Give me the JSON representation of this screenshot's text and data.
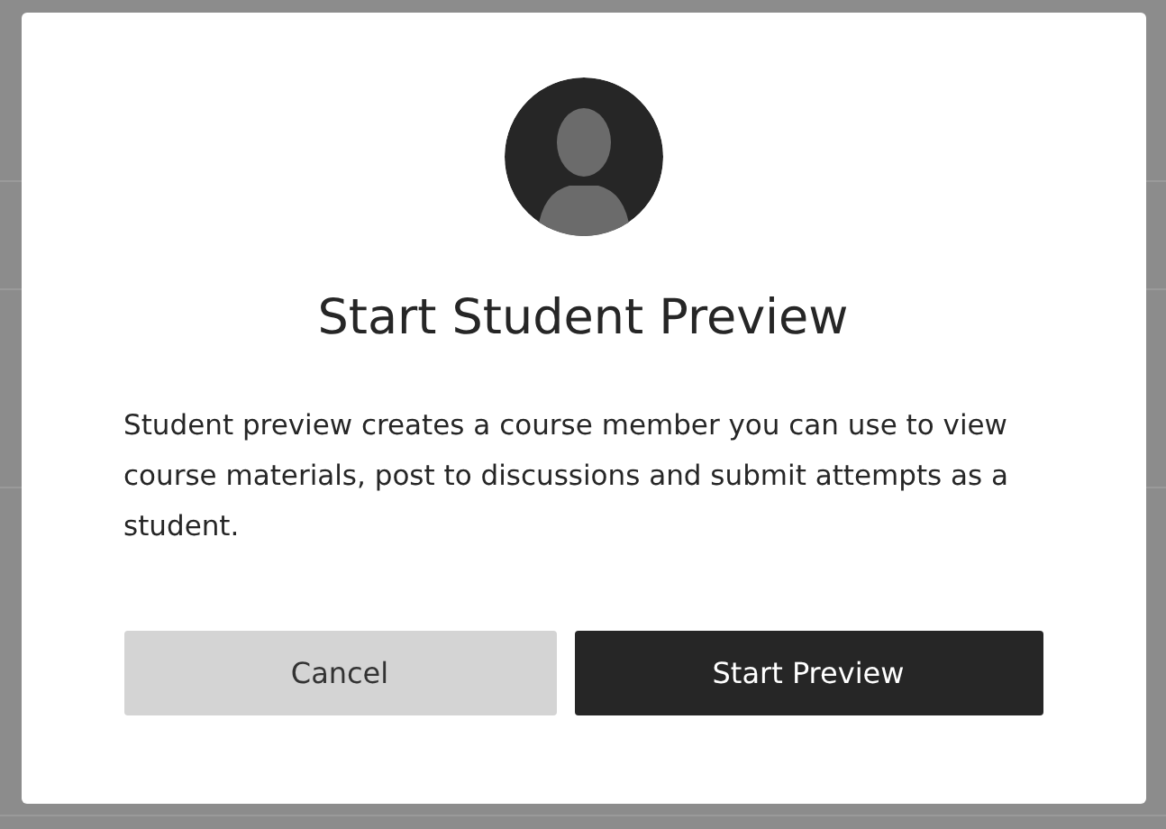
{
  "dialog": {
    "title": "Start Student Preview",
    "message": "Student preview creates a course member you can use to view course materials, post to discussions and submit attempts as a student.",
    "buttons": [
      {
        "label": "Cancel",
        "kind": "secondary"
      },
      {
        "label": "Start Preview",
        "kind": "primary"
      }
    ]
  }
}
